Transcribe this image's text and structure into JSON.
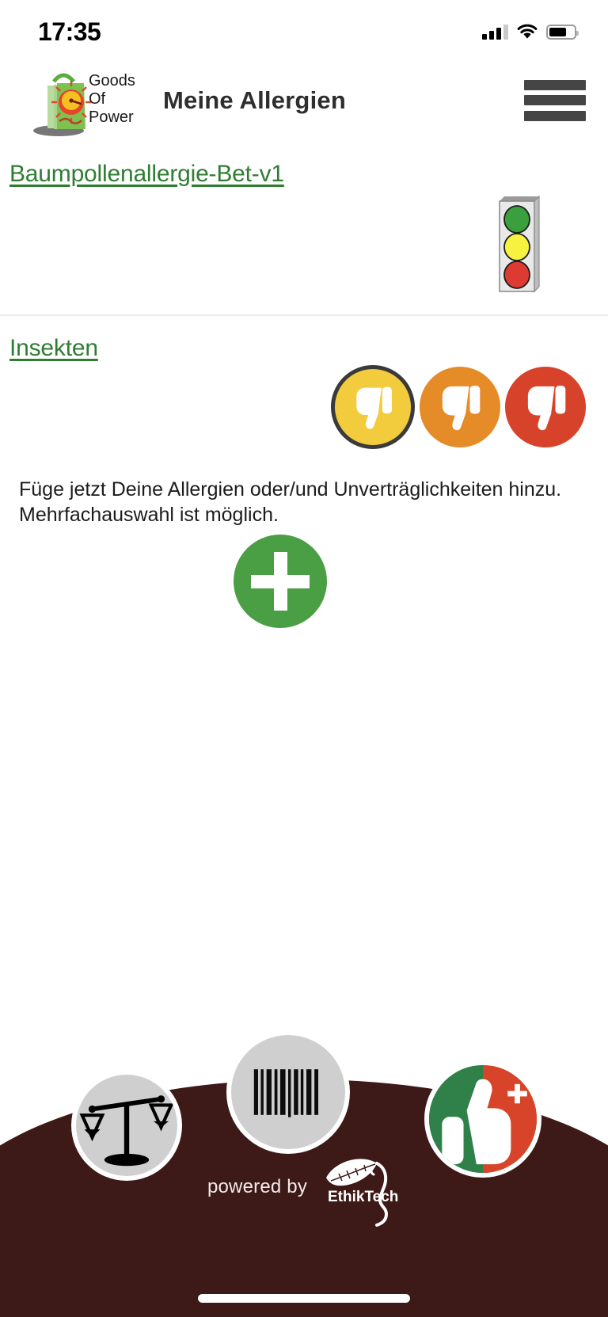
{
  "status_bar": {
    "time": "17:35",
    "signal_icon": "cellular-signal-icon",
    "wifi_icon": "wifi-icon",
    "battery_icon": "battery-icon",
    "battery_level_percent": 70,
    "signal_bars_filled": 3,
    "signal_bars_total": 4
  },
  "header": {
    "logo_alt": "Goods Of Power",
    "logo_line1": "Goods",
    "logo_line2": "Of",
    "logo_line3": "Power",
    "title": "Meine Allergien",
    "menu_icon": "hamburger-menu-icon"
  },
  "allergy_rows": [
    {
      "name": "Baumpollenallergie-Bet-v1",
      "control": "traffic-light",
      "traffic_light": {
        "green": "#3aa03e",
        "yellow": "#f7f23f",
        "red": "#dc3a32",
        "active": "none"
      }
    },
    {
      "name": "Insekten",
      "control": "thumbs-down-scale",
      "ratings": [
        {
          "level": "mild",
          "color": "#f2cc3c",
          "icon": "thumbs-down-icon",
          "selected": true
        },
        {
          "level": "medium",
          "color": "#e58b28",
          "icon": "thumbs-down-icon",
          "selected": false
        },
        {
          "level": "severe",
          "color": "#d7422a",
          "icon": "thumbs-down-icon",
          "selected": false
        }
      ]
    }
  ],
  "instructions": {
    "line1": "Füge jetzt Deine Allergien oder/und Unverträglichkeiten hinzu.",
    "line2": "Mehrfachauswahl ist möglich."
  },
  "add_button": {
    "icon": "plus-icon",
    "label": "Hinzufügen",
    "color": "#4a9e43"
  },
  "bottom_nav": {
    "background_color": "#3d1a17",
    "items": [
      {
        "id": "compare",
        "icon": "balance-scale-icon",
        "background": "#cfcfcf"
      },
      {
        "id": "scan",
        "icon": "barcode-icon",
        "background": "#cfcfcf"
      },
      {
        "id": "favorites",
        "icon": "thumbs-up-plus-icon",
        "background_left": "#2f8049",
        "background_right": "#d8442a"
      }
    ],
    "powered_by_text": "powered by",
    "powered_by_brand": "EthikTech",
    "powered_by_icon": "ethiktech-leaf-head-icon"
  },
  "colors": {
    "link_green": "#2f7d32",
    "title_gray": "#2e2e2e",
    "divider": "#ececec"
  }
}
